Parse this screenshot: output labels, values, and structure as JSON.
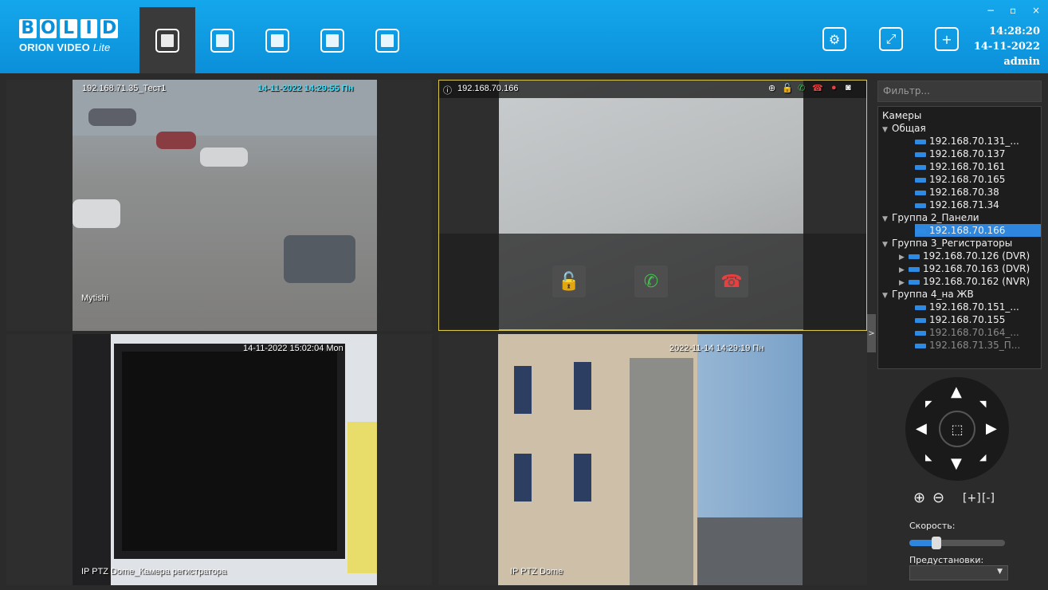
{
  "app": {
    "logo_letters": [
      "B",
      "O",
      "L",
      "I",
      "D"
    ],
    "logo_sub": "ORION VIDEO",
    "logo_sub_italic": "Lite"
  },
  "topbar": {
    "nav": [
      {
        "name": "live-view",
        "icon": "cctv-camera-icon",
        "active": true
      },
      {
        "name": "video-archive",
        "icon": "film-clapper-icon",
        "active": false
      },
      {
        "name": "event-log",
        "icon": "document-search-icon",
        "active": false
      },
      {
        "name": "floor-plan",
        "icon": "floor-plan-icon",
        "active": false
      },
      {
        "name": "layout",
        "icon": "grid-layout-icon",
        "active": false
      }
    ],
    "right_buttons": [
      "gear-icon",
      "fullscreen-icon",
      "add-window-icon"
    ],
    "window_controls": {
      "minimize": "−",
      "maximize": "▫",
      "close": "×"
    },
    "time": "14:28:20",
    "date": "14-11-2022",
    "user": "admin"
  },
  "cams": [
    {
      "title": "192.168.71.35_Тест1",
      "timestamp": "14-11-2022 14:29:55 Пн",
      "footer": "Mytishi"
    },
    {
      "title": "192.168.70.166"
    },
    {
      "title": "",
      "timestamp": "14-11-2022 15:02:04 Mon",
      "footer": "IP PTZ Dome_Камера регистратора"
    },
    {
      "title": "",
      "timestamp": "2022-11-14 14:29:19 Пн",
      "footer": "IP PTZ Dome"
    }
  ],
  "sidebar": {
    "filter_placeholder": "Фильтр...",
    "tree_root": "Камеры",
    "groups": [
      {
        "name": "Общая",
        "items": [
          "192.168.70.131_...",
          "192.168.70.137",
          "192.168.70.161",
          "192.168.70.165",
          "192.168.70.38",
          "192.168.71.34"
        ]
      },
      {
        "name": "Группа 2_Панели",
        "items": [
          "192.168.70.166"
        ]
      },
      {
        "name": "Группа 3_Регистраторы",
        "items": [
          "192.168.70.126 (DVR)",
          "192.168.70.163 (DVR)",
          "192.168.70.162 (NVR)"
        ]
      },
      {
        "name": "Группа 4_на ЖВ",
        "items": [
          "192.168.70.151_...",
          "192.168.70.155",
          "192.168.70.164_...",
          "192.168.71.35_П..."
        ]
      }
    ],
    "selected_item": "192.168.70.166"
  },
  "ptz": {
    "speed_label": "Скорость:",
    "speed_level": 0.28,
    "presets_label": "Предустановки:",
    "presets_value": ""
  }
}
